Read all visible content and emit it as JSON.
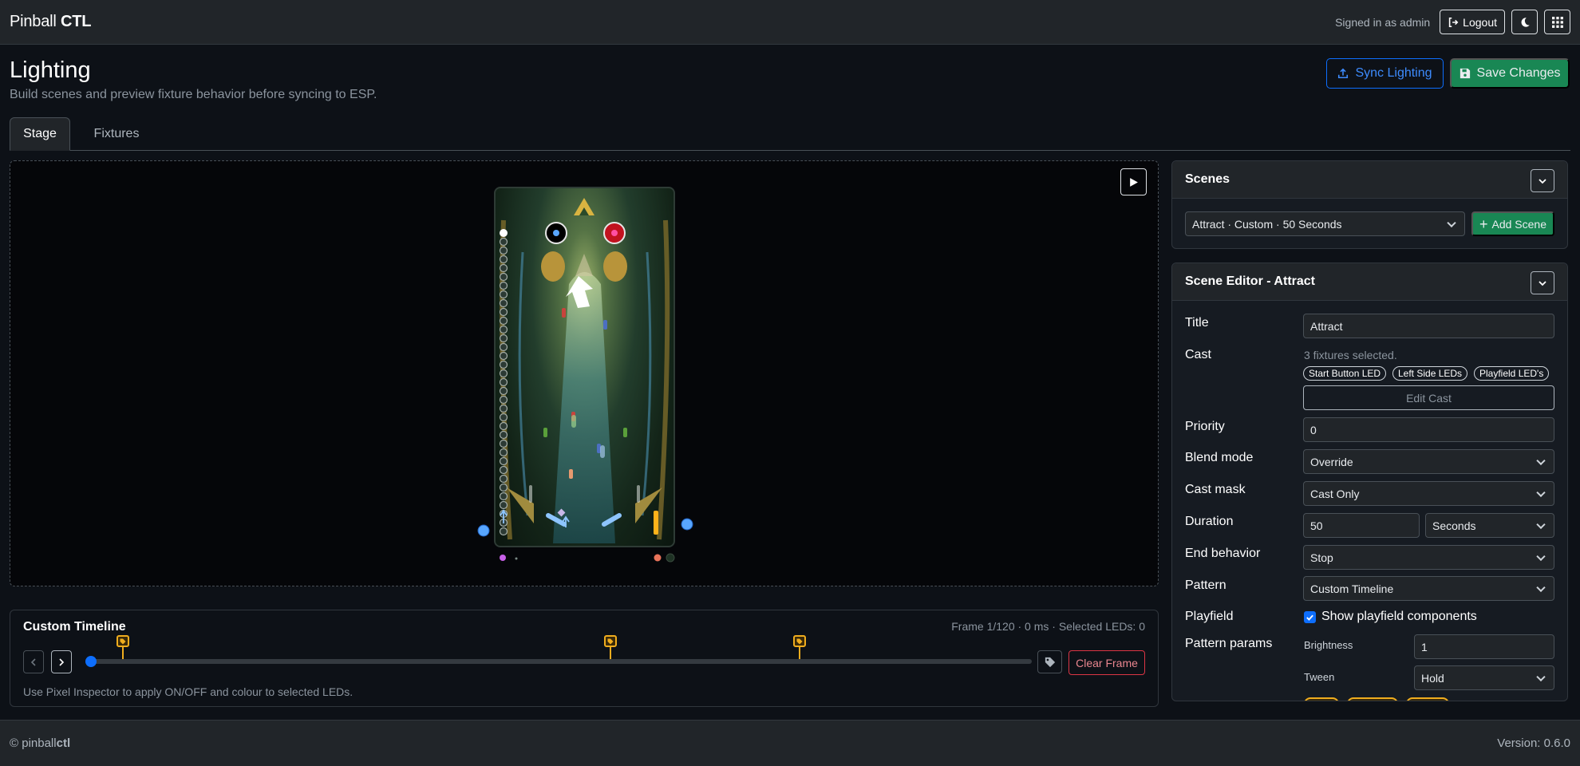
{
  "navbar": {
    "brand_light": "Pinball",
    "brand_bold": "CTL",
    "signed_in": "Signed in as admin",
    "logout_label": "Logout"
  },
  "page": {
    "title": "Lighting",
    "subtitle": "Build scenes and preview fixture behavior before syncing to ESP.",
    "sync_label": "Sync Lighting",
    "save_label": "Save Changes"
  },
  "tabs": [
    {
      "label": "Stage",
      "active": true
    },
    {
      "label": "Fixtures",
      "active": false
    }
  ],
  "scenes": {
    "heading": "Scenes",
    "selected": "Attract · Custom · 50 Seconds",
    "add_label": "Add Scene"
  },
  "editor": {
    "heading": "Scene Editor - Attract",
    "title_label": "Title",
    "title_value": "Attract",
    "cast_label": "Cast",
    "cast_status": "3 fixtures selected.",
    "cast_badges": [
      "Start Button LED",
      "Left Side LEDs",
      "Playfield LED's"
    ],
    "edit_cast_label": "Edit Cast",
    "priority_label": "Priority",
    "priority_value": "0",
    "blend_label": "Blend mode",
    "blend_value": "Override",
    "mask_label": "Cast mask",
    "mask_value": "Cast Only",
    "duration_label": "Duration",
    "duration_value": "50",
    "duration_unit": "Seconds",
    "end_label": "End behavior",
    "end_value": "Stop",
    "pattern_label": "Pattern",
    "pattern_value": "Custom Timeline",
    "playfield_label": "Playfield",
    "playfield_checkbox": "Show playfield components",
    "playfield_checked": true,
    "params_label": "Pattern params",
    "brightness_label": "Brightness",
    "brightness_value": "1",
    "tween_label": "Tween",
    "tween_value": "Hold"
  },
  "timeline": {
    "heading": "Custom Timeline",
    "status": "Frame 1/120 · 0 ms · Selected LEDs: 0",
    "clear_label": "Clear Frame",
    "hint": "Use Pixel Inspector to apply ON/OFF and colour to selected LEDs.",
    "total_frames": 120,
    "current_frame": 1,
    "keyframe_positions": [
      0.04,
      0.555,
      0.755
    ]
  },
  "footer": {
    "copyright": "© ",
    "brand_light": "pinball",
    "brand_bold": "ctl",
    "version": "Version: 0.6.0"
  },
  "colors": {
    "primary": "#0d6efd",
    "success": "#198754",
    "danger": "#dc3545",
    "keyframe": "#f0ad1e"
  }
}
